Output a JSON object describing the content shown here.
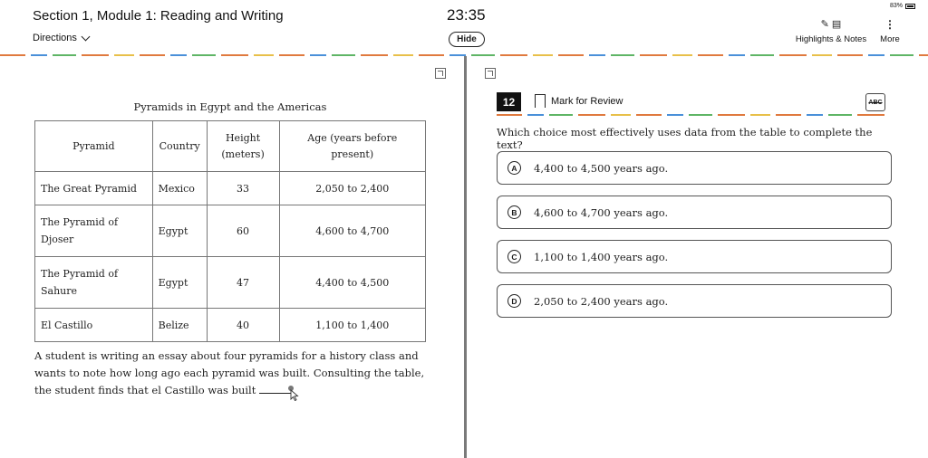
{
  "header": {
    "section_title": "Section 1, Module 1: Reading and Writing",
    "directions_label": "Directions",
    "timer": "23:35",
    "hide_label": "Hide",
    "battery": "83%",
    "highlights_label": "Highlights & Notes",
    "more_label": "More"
  },
  "passage": {
    "table_caption": "Pyramids in Egypt and the Americas",
    "columns": [
      "Pyramid",
      "Country",
      "Height (meters)",
      "Age (years before present)"
    ],
    "rows": [
      [
        "The Great Pyramid",
        "Mexico",
        "33",
        "2,050 to 2,400"
      ],
      [
        "The Pyramid of Djoser",
        "Egypt",
        "60",
        "4,600 to 4,700"
      ],
      [
        "The Pyramid of Sahure",
        "Egypt",
        "47",
        "4,400 to 4,500"
      ],
      [
        "El Castillo",
        "Belize",
        "40",
        "1,100 to 1,400"
      ]
    ],
    "text": "A student is writing an essay about four pyramids for a history class and wants to note how long ago each pyramid was built. Consulting the table, the student finds that el Castillo was built"
  },
  "question": {
    "number": "12",
    "mark_label": "Mark for Review",
    "abc_label": "ABC",
    "prompt": "Which choice most effectively uses data from the table to complete the text?",
    "choices": [
      {
        "letter": "A",
        "text": "4,400 to 4,500 years ago."
      },
      {
        "letter": "B",
        "text": "4,600 to 4,700 years ago."
      },
      {
        "letter": "C",
        "text": "1,100 to 1,400 years ago."
      },
      {
        "letter": "D",
        "text": "2,050 to 2,400 years ago."
      }
    ]
  }
}
